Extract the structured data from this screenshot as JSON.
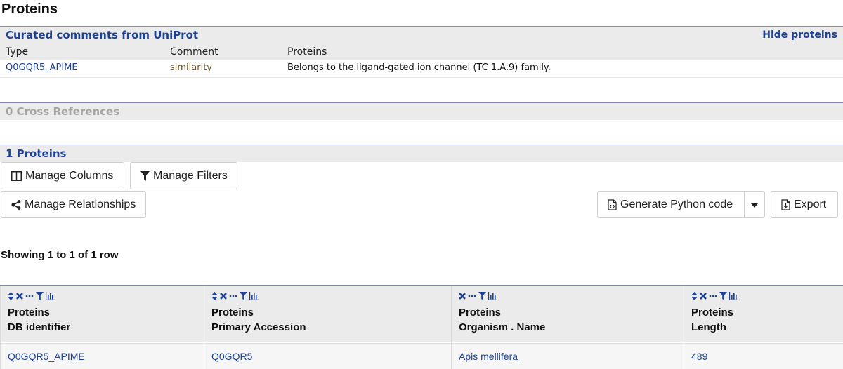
{
  "page_title": "Proteins",
  "curated": {
    "title": "Curated comments from UniProt",
    "hide_link": "Hide proteins",
    "columns": [
      "Type",
      "Comment",
      "Proteins"
    ],
    "rows": [
      [
        "Q0GQR5_APIME",
        "similarity",
        "Belongs to the ligand-gated ion channel (TC 1.A.9) family."
      ]
    ]
  },
  "cross_refs": {
    "title": "0 Cross References"
  },
  "proteins": {
    "title": "1 Proteins",
    "buttons": {
      "manage_columns": "Manage Columns",
      "manage_filters": "Manage Filters",
      "manage_relationships": "Manage Relationships",
      "generate_code": "Generate Python code",
      "export": "Export"
    },
    "showing": "Showing 1 to 1 of 1 row",
    "columns": [
      {
        "line1": "Proteins",
        "line2": "DB identifier",
        "sortable": true
      },
      {
        "line1": "Proteins",
        "line2": "Primary Accession",
        "sortable": true
      },
      {
        "line1": "Proteins",
        "line2": "Organism . Name",
        "sortable": false
      },
      {
        "line1": "Proteins",
        "line2": "Length",
        "sortable": true
      }
    ],
    "rows": [
      [
        "Q0GQR5_APIME",
        "Q0GQR5",
        "Apis mellifera",
        "489"
      ]
    ]
  },
  "colors": {
    "link": "#1d4296",
    "header_bg": "#ebebeb",
    "border_accent": "#7f8ba8"
  }
}
